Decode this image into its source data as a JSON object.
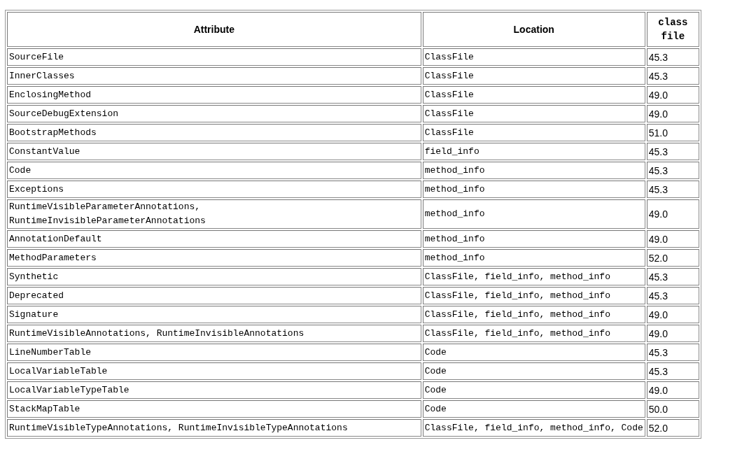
{
  "table": {
    "columns": [
      "Attribute",
      "Location",
      "class file"
    ],
    "rows": [
      {
        "attribute": "SourceFile",
        "location": "ClassFile",
        "version": "45.3"
      },
      {
        "attribute": "InnerClasses",
        "location": "ClassFile",
        "version": "45.3"
      },
      {
        "attribute": "EnclosingMethod",
        "location": "ClassFile",
        "version": "49.0"
      },
      {
        "attribute": "SourceDebugExtension",
        "location": "ClassFile",
        "version": "49.0"
      },
      {
        "attribute": "BootstrapMethods",
        "location": "ClassFile",
        "version": "51.0"
      },
      {
        "attribute": "ConstantValue",
        "location": "field_info",
        "version": "45.3"
      },
      {
        "attribute": "Code",
        "location": "method_info",
        "version": "45.3"
      },
      {
        "attribute": "Exceptions",
        "location": "method_info",
        "version": "45.3"
      },
      {
        "attribute": "RuntimeVisibleParameterAnnotations,\nRuntimeInvisibleParameterAnnotations",
        "location": "method_info",
        "version": "49.0"
      },
      {
        "attribute": "AnnotationDefault",
        "location": "method_info",
        "version": "49.0"
      },
      {
        "attribute": "MethodParameters",
        "location": "method_info",
        "version": "52.0"
      },
      {
        "attribute": "Synthetic",
        "location": "ClassFile, field_info, method_info",
        "version": "45.3"
      },
      {
        "attribute": "Deprecated",
        "location": "ClassFile, field_info, method_info",
        "version": "45.3"
      },
      {
        "attribute": "Signature",
        "location": "ClassFile, field_info, method_info",
        "version": "49.0"
      },
      {
        "attribute": "RuntimeVisibleAnnotations, RuntimeInvisibleAnnotations",
        "location": "ClassFile, field_info, method_info",
        "version": "49.0"
      },
      {
        "attribute": "LineNumberTable",
        "location": "Code",
        "version": "45.3"
      },
      {
        "attribute": "LocalVariableTable",
        "location": "Code",
        "version": "45.3"
      },
      {
        "attribute": "LocalVariableTypeTable",
        "location": "Code",
        "version": "49.0"
      },
      {
        "attribute": "StackMapTable",
        "location": "Code",
        "version": "50.0"
      },
      {
        "attribute": "RuntimeVisibleTypeAnnotations, RuntimeInvisibleTypeAnnotations",
        "location": "ClassFile, field_info, method_info, Code",
        "version": "52.0"
      }
    ]
  }
}
